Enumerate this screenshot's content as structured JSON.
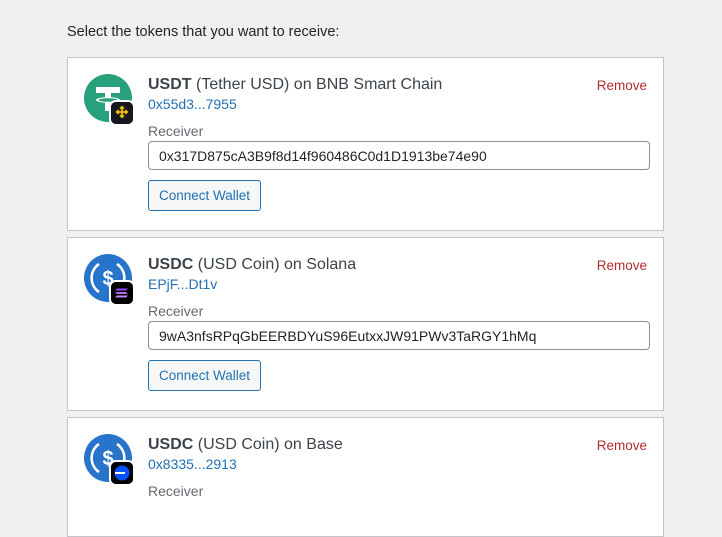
{
  "intro_text": "Select the tokens that you want to receive:",
  "colors": {
    "link": "#2271b1",
    "remove": "#b32d2e",
    "tether": "#26a17b",
    "usdc": "#2775ca"
  },
  "tokens": [
    {
      "symbol": "USDT",
      "name_suffix": " (Tether USD) on BNB Smart Chain",
      "address": "0x55d3...7955",
      "remove_label": "Remove",
      "receiver_label": "Receiver",
      "receiver_value": "0x317D875cA3B9f8d14f960486C0d1D1913be74e90",
      "connect_label": "Connect Wallet",
      "token_icon": "tether-icon",
      "chain_icon": "bnb-chain-icon"
    },
    {
      "symbol": "USDC",
      "name_suffix": " (USD Coin) on Solana",
      "address": "EPjF...Dt1v",
      "remove_label": "Remove",
      "receiver_label": "Receiver",
      "receiver_value": "9wA3nfsRPqGbEERBDYuS96EutxxJW91PWv3TaRGY1hMq",
      "connect_label": "Connect Wallet",
      "token_icon": "usdc-icon",
      "chain_icon": "solana-icon"
    },
    {
      "symbol": "USDC",
      "name_suffix": " (USD Coin) on Base",
      "address": "0x8335...2913",
      "remove_label": "Remove",
      "receiver_label": "Receiver",
      "token_icon": "usdc-icon",
      "chain_icon": "base-icon"
    }
  ]
}
